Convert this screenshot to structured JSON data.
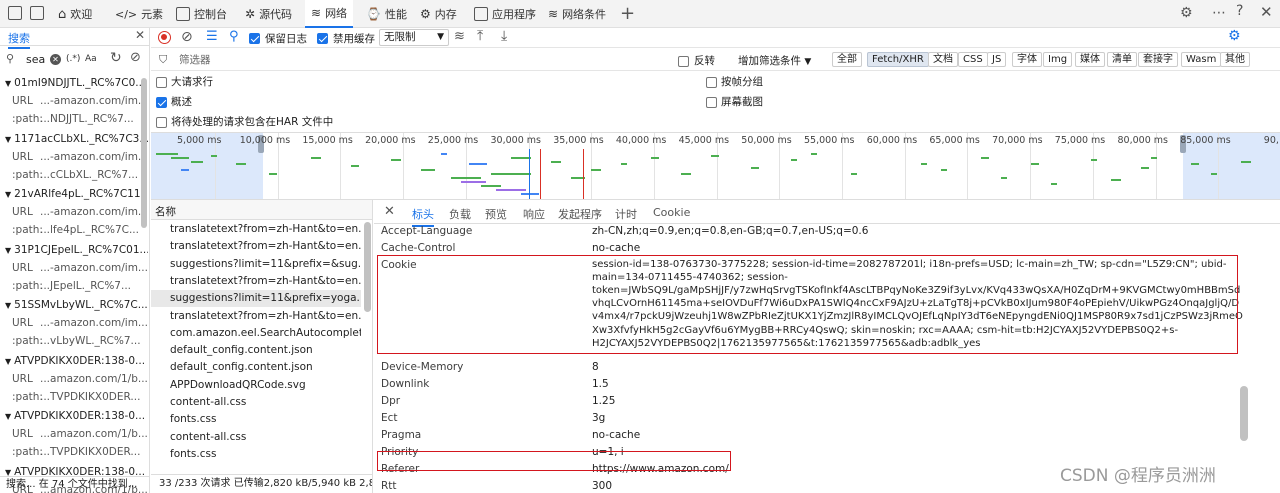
{
  "tabs": [
    {
      "label": "欢迎",
      "icon": "home-icon"
    },
    {
      "label": "元素",
      "icon": "code-icon"
    },
    {
      "label": "控制台",
      "icon": "console-icon"
    },
    {
      "label": "源代码",
      "icon": "bug-icon"
    },
    {
      "label": "网络",
      "icon": "wifi-icon"
    },
    {
      "label": "性能",
      "icon": "performance-icon"
    },
    {
      "label": "内存",
      "icon": "memory-icon"
    },
    {
      "label": "应用程序",
      "icon": "application-icon"
    },
    {
      "label": "网络条件",
      "icon": "network-conditions-icon"
    }
  ],
  "search": {
    "tab_label": "搜索",
    "query": "sea",
    "regex_label": "(.*)",
    "case_label": "Aa",
    "results": [
      {
        "title": "01mI9NDJJTL._RC%7C0...",
        "url_key": "URL",
        "url_val": "...-amazon.com/im...",
        "path_key": ":path:",
        "path_val": "...NDJJTL._RC%7..."
      },
      {
        "title": "1171acCLbXL._RC%7C3...",
        "url_key": "URL",
        "url_val": "...-amazon.com/im...",
        "path_key": ":path:",
        "path_val": "...cCLbXL._RC%7..."
      },
      {
        "title": "21vARlfe4pL._RC%7C11...",
        "url_key": "URL",
        "url_val": "...-amazon.com/im...",
        "path_key": ":path:",
        "path_val": "...lfe4pL._RC%7C..."
      },
      {
        "title": "31P1CJEpelL._RC%7C01...",
        "url_key": "URL",
        "url_val": "...-amazon.com/im...",
        "path_key": ":path:",
        "path_val": "...JEpelL._RC%7..."
      },
      {
        "title": "51SSMvLbyWL._RC%7C...",
        "url_key": "URL",
        "url_val": "...-amazon.com/im...",
        "path_key": ":path:",
        "path_val": "...vLbyWL._RC%7..."
      },
      {
        "title": "ATVPDKIKX0DER:138-0...",
        "url_key": "URL",
        "url_val": "...amazon.com/1/b...",
        "path_key": ":path:",
        "path_val": "...TVPDKIKX0DER..."
      },
      {
        "title": "ATVPDKIKX0DER:138-0...",
        "url_key": "URL",
        "url_val": "...amazon.com/1/b...",
        "path_key": ":path:",
        "path_val": "...TVPDKIKX0DER..."
      },
      {
        "title": "ATVPDKIKX0DER:138-0...",
        "url_key": "URL",
        "url_val": "...amazon.com/1/b...",
        "path_key": ":path:",
        "path_val": "...TVPDKIKX0DER..."
      }
    ],
    "footer": "搜索...   在 74 个文件中找到..."
  },
  "toolbar": {
    "preserve_log": "保留日志",
    "disable_cache": "禁用缓存",
    "throttle": "无限制"
  },
  "filter": {
    "placeholder": "筛选器",
    "invert": "反转",
    "more_filters": "增加筛选条件",
    "types": [
      "全部",
      "Fetch/XHR",
      "文档",
      "CSS",
      "JS",
      "字体",
      "Img",
      "媒体",
      "清单",
      "套接字",
      "Wasm",
      "其他"
    ],
    "selected_type": "Fetch/XHR"
  },
  "options": {
    "big_rows": "大请求行",
    "overview": "概述",
    "har_pending": "将待处理的请求包含在HAR 文件中",
    "group_by_frame": "按帧分组",
    "screenshots": "屏幕截图"
  },
  "timeline": {
    "ticks": [
      "5,000 ms",
      "10,000 ms",
      "15,000 ms",
      "20,000 ms",
      "25,000 ms",
      "30,000 ms",
      "35,000 ms",
      "40,000 ms",
      "45,000 ms",
      "50,000 ms",
      "55,000 ms",
      "60,000 ms",
      "65,000 ms",
      "70,000 ms",
      "75,000 ms",
      "80,000 ms",
      "85,000 ms",
      "90,"
    ]
  },
  "requests": {
    "header": "名称",
    "items": [
      "translatetext?from=zh-Hant&to=en...",
      "translatetext?from=zh-Hant&to=en...",
      "suggestions?limit=11&prefix=&sug...",
      "translatetext?from=zh-Hant&to=en...",
      "suggestions?limit=11&prefix=yoga...",
      "translatetext?from=zh-Hant&to=en...",
      "com.amazon.eel.SearchAutocomplet...",
      "default_config.content.json",
      "default_config.content.json",
      "APPDownloadQRCode.svg",
      "content-all.css",
      "fonts.css",
      "content-all.css",
      "fonts.css"
    ],
    "status": "33 /233 次请求   已传输2,820 kB/5,940 kB   2,8"
  },
  "detail": {
    "tabs": [
      "标头",
      "负载",
      "预览",
      "响应",
      "发起程序",
      "计时",
      "Cookie"
    ],
    "active_tab": "标头",
    "headers": [
      {
        "key": "Accept-Language",
        "value": "zh-CN,zh;q=0.9,en;q=0.8,en-GB;q=0.7,en-US;q=0.6"
      },
      {
        "key": "Cache-Control",
        "value": "no-cache"
      },
      {
        "key": "Cookie",
        "value_lines": [
          "session-id=138-0763730-3775228; session-id-time=2082787201l; i18n-prefs=USD; lc-main=zh_TW; sp-cdn=\"L5Z9:CN\"; ubid-",
          "main=134-0711455-4740362; session-",
          "token=JWbSQ9L/gaMpSHjJF/y7zwHqSrvgTSKofInkf4AscLTBPqyNoKe3Z9if3yLvx/KVq433wQsXA/H0ZqDrM+9KVGMCtwy0mHBBmSd",
          "vhqLCvOrnH61145ma+seIOVDuFf7Wi6uDxPA1SWlQ4ncCxF9AJzU+zLaTgT8j+pCVkB0xIJum980F4oPEpiehV/UikwPGz4OnqaJgljQ/D",
          "v4mx4/r7pckU9jWzeuhj1W8wZPbRIeZjtUKX1YjZmzJlR8yIMCLQvOJEfLqNpIY3dT6eNEpyngdENi0QJ1MSP80R9x7sd1jCzPSWz3jRmeO",
          "Xw3XfvfyHkH5g2cGayVf6u6YMygBB+RRCy4QswQ; skin=noskin; rxc=AAAA; csm-hit=tb:H2JCYAXJ52VYDEPBS0Q2+s-",
          "H2JCYAXJ52VYDEPBS0Q2|1762135977565&t:1762135977565&adb:adblk_yes"
        ]
      },
      {
        "key": "Device-Memory",
        "value": "8"
      },
      {
        "key": "Downlink",
        "value": "1.5"
      },
      {
        "key": "Dpr",
        "value": "1.25"
      },
      {
        "key": "Ect",
        "value": "3g"
      },
      {
        "key": "Pragma",
        "value": "no-cache"
      },
      {
        "key": "Priority",
        "value": "u=1, i"
      },
      {
        "key": "Referer",
        "value": "https://www.amazon.com/"
      },
      {
        "key": "Rtt",
        "value": "300"
      }
    ]
  },
  "watermark": "CSDN @程序员洲洲"
}
